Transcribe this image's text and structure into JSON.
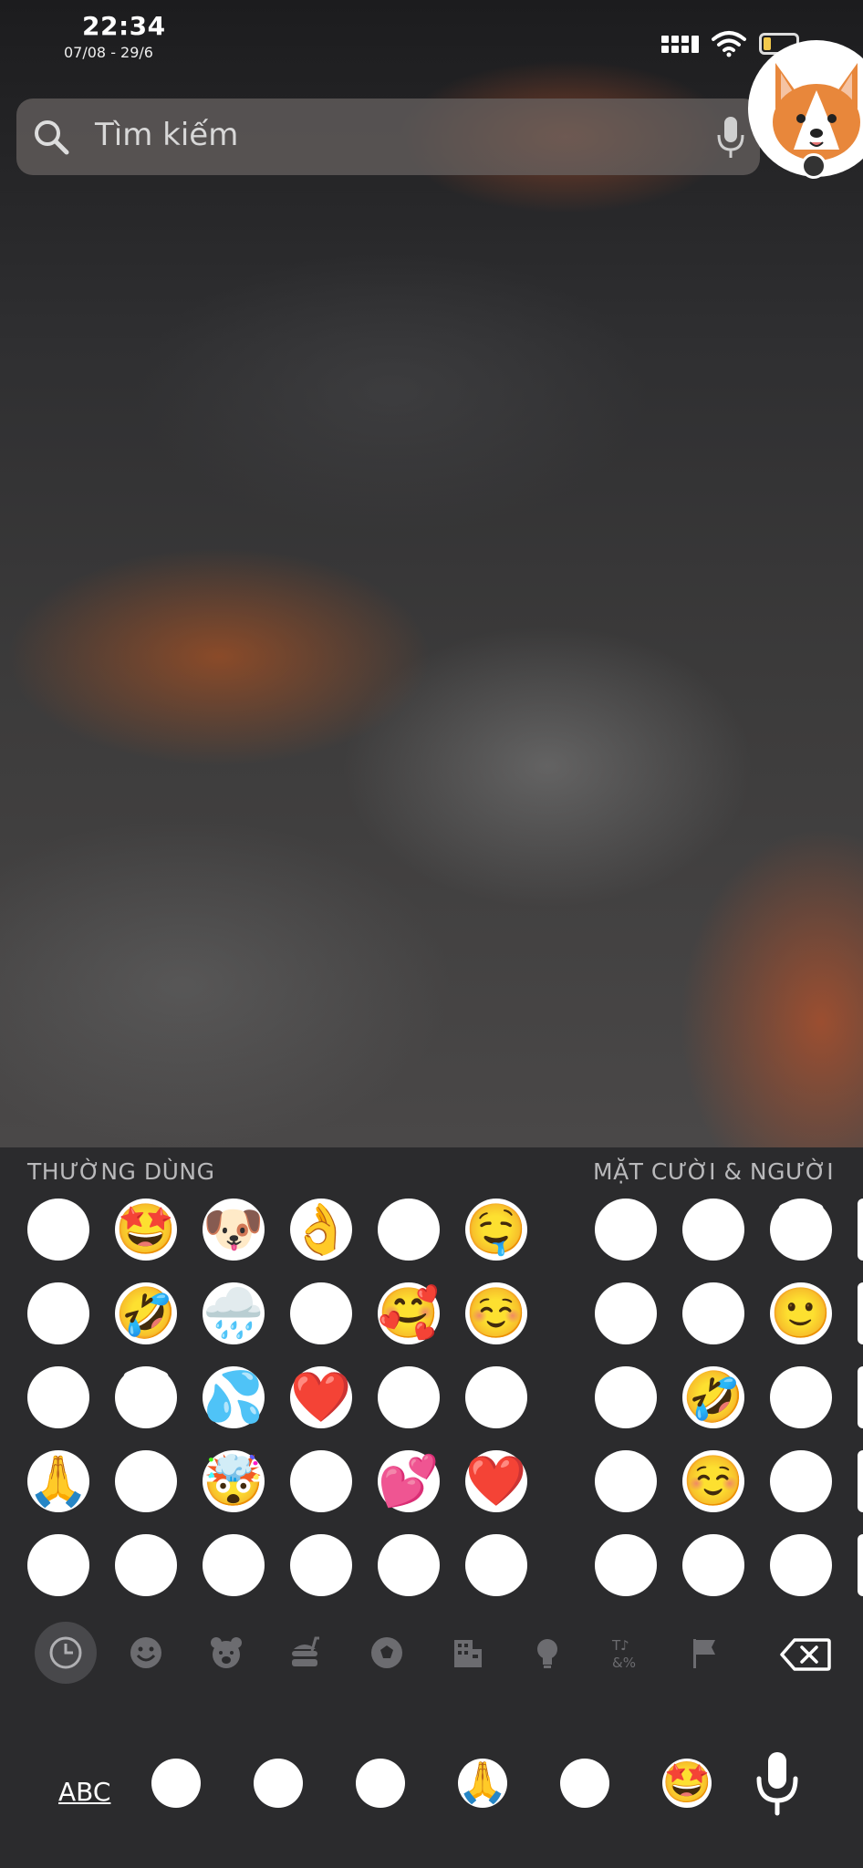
{
  "status_bar": {
    "time": "22:34",
    "date": "07/08 - 29/6",
    "icons": [
      "signal-icon",
      "wifi-icon",
      "battery-icon"
    ]
  },
  "search": {
    "placeholder": "Tìm kiếm",
    "icon": "search-icon",
    "voice_icon": "microphone-icon"
  },
  "avatar": {
    "icon": "corgi-avatar",
    "badge": "camera-icon"
  },
  "keyboard": {
    "sections": [
      {
        "label": "THƯỜNG DÙNG"
      },
      {
        "label": "MẶT CƯỜI & NGƯỜI"
      }
    ],
    "frequent": [
      [
        "😂",
        "🤩",
        "🐶",
        "👌",
        "😗",
        "🤤"
      ],
      [
        "😎",
        "🤣",
        "🌧️",
        "😁",
        "🥰",
        "☺️"
      ],
      [
        "😅",
        "😇",
        "💦",
        "❤️",
        "🙃",
        "😂"
      ],
      [
        "🙏",
        "😀",
        "🤯",
        "😊",
        "💕",
        "❤️"
      ],
      [
        "😔",
        "😌",
        "😍",
        "😘",
        "😭",
        "😍"
      ]
    ],
    "smileys": [
      [
        "😀",
        "😅",
        "😇"
      ],
      [
        "😃",
        "😂",
        "🙂"
      ],
      [
        "😁",
        "🤣",
        "🙃"
      ],
      [
        "😁",
        "☺️",
        "😉"
      ],
      [
        "😆",
        "😊",
        "😌"
      ]
    ],
    "categories": [
      {
        "name": "recent",
        "icon": "clock-icon",
        "active": true
      },
      {
        "name": "smileys",
        "icon": "smiley-icon"
      },
      {
        "name": "animals",
        "icon": "bear-icon"
      },
      {
        "name": "food",
        "icon": "food-icon"
      },
      {
        "name": "activity",
        "icon": "soccer-ball-icon"
      },
      {
        "name": "travel",
        "icon": "building-icon"
      },
      {
        "name": "objects",
        "icon": "lightbulb-icon"
      },
      {
        "name": "symbols",
        "icon": "symbols-icon"
      },
      {
        "name": "flags",
        "icon": "flag-icon"
      }
    ],
    "backspace_icon": "backspace-icon",
    "abc_label": "ABC",
    "recent_bar": [
      "😂",
      "😎",
      "😅",
      "🙏",
      "😔",
      "🤩"
    ],
    "mic_icon": "microphone-icon"
  },
  "colors": {
    "keyboard_bg": "#2b2b2d",
    "search_bg": "#69645f",
    "label_gray": "#b9b9bb",
    "battery_yellow": "#f2c94c"
  }
}
